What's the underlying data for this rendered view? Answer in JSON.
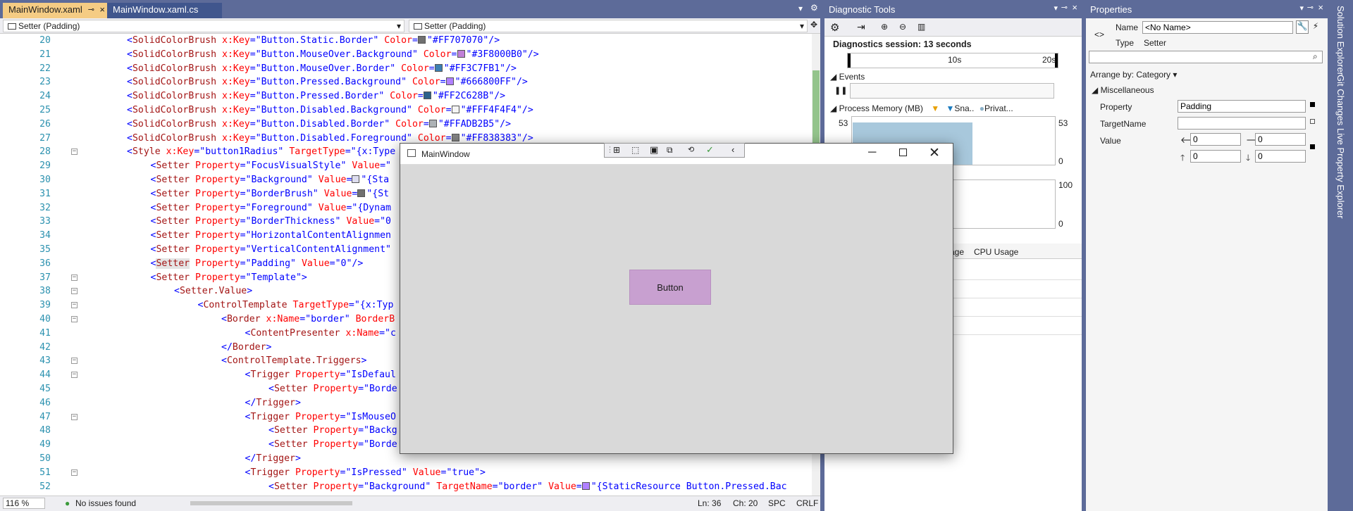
{
  "tabs": [
    {
      "label": "MainWindow.xaml",
      "active": true
    },
    {
      "label": "MainWindow.xaml.cs",
      "active": false
    }
  ],
  "nav": {
    "left": "Setter (Padding)",
    "right": "Setter (Padding)"
  },
  "code_lines": [
    {
      "n": "20",
      "indent": 0,
      "html": "<span class='cb'>&lt;</span><span class='cbr'>SolidColorBrush</span> <span class='cr'>x:Key</span><span class='cb'>=\"Button.Static.Border\"</span> <span class='cr'>Color</span><span class='cb'>=</span><span class='sw' style='background:#707070'></span><span class='cb'>\"#FF707070\"/&gt;</span>"
    },
    {
      "n": "21",
      "indent": 0,
      "html": "<span class='cb'>&lt;</span><span class='cbr'>SolidColorBrush</span> <span class='cr'>x:Key</span><span class='cb'>=\"Button.MouseOver.Background\"</span> <span class='cr'>Color</span><span class='cb'>=</span><span class='sw' style='background:#c080d8'></span><span class='cb'>\"#3F8000B0\"/&gt;</span>"
    },
    {
      "n": "22",
      "indent": 0,
      "html": "<span class='cb'>&lt;</span><span class='cbr'>SolidColorBrush</span> <span class='cr'>x:Key</span><span class='cb'>=\"Button.MouseOver.Border\"</span> <span class='cr'>Color</span><span class='cb'>=</span><span class='sw' style='background:#3c7fb1'></span><span class='cb'>\"#FF3C7FB1\"/&gt;</span>"
    },
    {
      "n": "23",
      "indent": 0,
      "html": "<span class='cb'>&lt;</span><span class='cbr'>SolidColorBrush</span> <span class='cr'>x:Key</span><span class='cb'>=\"Button.Pressed.Background\"</span> <span class='cr'>Color</span><span class='cb'>=</span><span class='sw' style='background:#b080ff'></span><span class='cb'>\"#666800FF\"/&gt;</span>"
    },
    {
      "n": "24",
      "indent": 0,
      "html": "<span class='cb'>&lt;</span><span class='cbr'>SolidColorBrush</span> <span class='cr'>x:Key</span><span class='cb'>=\"Button.Pressed.Border\"</span> <span class='cr'>Color</span><span class='cb'>=</span><span class='sw' style='background:#2c628b'></span><span class='cb'>\"#FF2C628B\"/&gt;</span>"
    },
    {
      "n": "25",
      "indent": 0,
      "html": "<span class='cb'>&lt;</span><span class='cbr'>SolidColorBrush</span> <span class='cr'>x:Key</span><span class='cb'>=\"Button.Disabled.Background\"</span> <span class='cr'>Color</span><span class='cb'>=</span><span class='sw' style='background:#f4f4f4'></span><span class='cb'>\"#FFF4F4F4\"/&gt;</span>"
    },
    {
      "n": "26",
      "indent": 0,
      "html": "<span class='cb'>&lt;</span><span class='cbr'>SolidColorBrush</span> <span class='cr'>x:Key</span><span class='cb'>=\"Button.Disabled.Border\"</span> <span class='cr'>Color</span><span class='cb'>=</span><span class='sw' style='background:#adb2b5'></span><span class='cb'>\"#FFADB2B5\"/&gt;</span>"
    },
    {
      "n": "27",
      "indent": 0,
      "html": "<span class='cb'>&lt;</span><span class='cbr'>SolidColorBrush</span> <span class='cr'>x:Key</span><span class='cb'>=\"Button.Disabled.Foreground\"</span> <span class='cr'>Color</span><span class='cb'>=</span><span class='sw' style='background:#838383'></span><span class='cb'>\"#FF838383\"/&gt;</span>"
    },
    {
      "n": "28",
      "indent": 0,
      "html": "<span class='cb'>&lt;</span><span class='cbr'>Style</span> <span class='cr'>x:Key</span><span class='cb'>=\"button1Radius\"</span> <span class='cr'>TargetType</span><span class='cb'>=\"{x:Type</span>"
    },
    {
      "n": "29",
      "indent": 1,
      "html": "<span class='cb'>&lt;</span><span class='cbr'>Setter</span> <span class='cr'>Property</span><span class='cb'>=\"FocusVisualStyle\"</span> <span class='cr'>Value</span><span class='cb'>=\"</span>"
    },
    {
      "n": "30",
      "indent": 1,
      "html": "<span class='cb'>&lt;</span><span class='cbr'>Setter</span> <span class='cr'>Property</span><span class='cb'>=\"Background\"</span> <span class='cr'>Value</span><span class='cb'>=</span><span class='sw' style='background:#dde'></span><span class='cb'>\"{Sta</span>"
    },
    {
      "n": "31",
      "indent": 1,
      "html": "<span class='cb'>&lt;</span><span class='cbr'>Setter</span> <span class='cr'>Property</span><span class='cb'>=\"BorderBrush\"</span> <span class='cr'>Value</span><span class='cb'>=</span><span class='sw' style='background:#707070'></span><span class='cb'>\"{St</span>"
    },
    {
      "n": "32",
      "indent": 1,
      "html": "<span class='cb'>&lt;</span><span class='cbr'>Setter</span> <span class='cr'>Property</span><span class='cb'>=\"Foreground\"</span> <span class='cr'>Value</span><span class='cb'>=\"{Dynam</span>"
    },
    {
      "n": "33",
      "indent": 1,
      "html": "<span class='cb'>&lt;</span><span class='cbr'>Setter</span> <span class='cr'>Property</span><span class='cb'>=\"BorderThickness\"</span> <span class='cr'>Value</span><span class='cb'>=\"0</span>"
    },
    {
      "n": "34",
      "indent": 1,
      "html": "<span class='cb'>&lt;</span><span class='cbr'>Setter</span> <span class='cr'>Property</span><span class='cb'>=\"HorizontalContentAlignmen</span>"
    },
    {
      "n": "35",
      "indent": 1,
      "html": "<span class='cb'>&lt;</span><span class='cbr'>Setter</span> <span class='cr'>Property</span><span class='cb'>=\"VerticalContentAlignment\"</span>"
    },
    {
      "n": "36",
      "indent": 1,
      "html": "<span class='cb'>&lt;</span><span class='cbr' style='background:#e4e4e4'>Setter</span> <span class='cr'>Property</span><span class='cb'>=\"Padding\"</span> <span class='cr'>Value</span><span class='cb'>=\"0\"/&gt;</span>"
    },
    {
      "n": "37",
      "indent": 1,
      "html": "<span class='cb'>&lt;</span><span class='cbr'>Setter</span> <span class='cr'>Property</span><span class='cb'>=\"Template\"&gt;</span>"
    },
    {
      "n": "38",
      "indent": 2,
      "html": "<span class='cb'>&lt;</span><span class='cbr'>Setter.Value</span><span class='cb'>&gt;</span>"
    },
    {
      "n": "39",
      "indent": 3,
      "html": "<span class='cb'>&lt;</span><span class='cbr'>ControlTemplate</span> <span class='cr'>TargetType</span><span class='cb'>=\"{x:Typ</span>"
    },
    {
      "n": "40",
      "indent": 4,
      "html": "<span class='cb'>&lt;</span><span class='cbr'>Border</span> <span class='cr'>x:Name</span><span class='cb'>=\"border\"</span> <span class='cr'>BorderB</span>"
    },
    {
      "n": "41",
      "indent": 5,
      "html": "<span class='cb'>&lt;</span><span class='cbr'>ContentPresenter</span> <span class='cr'>x:Name</span><span class='cb'>=\"c</span>"
    },
    {
      "n": "42",
      "indent": 4,
      "html": "<span class='cb'>&lt;/</span><span class='cbr'>Border</span><span class='cb'>&gt;</span>"
    },
    {
      "n": "43",
      "indent": 4,
      "html": "<span class='cb'>&lt;</span><span class='cbr'>ControlTemplate.Triggers</span><span class='cb'>&gt;</span>"
    },
    {
      "n": "44",
      "indent": 5,
      "html": "<span class='cb'>&lt;</span><span class='cbr'>Trigger</span> <span class='cr'>Property</span><span class='cb'>=\"IsDefaul</span>"
    },
    {
      "n": "45",
      "indent": 6,
      "html": "<span class='cb'>&lt;</span><span class='cbr'>Setter</span> <span class='cr'>Property</span><span class='cb'>=\"Borde</span>"
    },
    {
      "n": "46",
      "indent": 5,
      "html": "<span class='cb'>&lt;/</span><span class='cbr'>Trigger</span><span class='cb'>&gt;</span>"
    },
    {
      "n": "47",
      "indent": 5,
      "html": "<span class='cb'>&lt;</span><span class='cbr'>Trigger</span> <span class='cr'>Property</span><span class='cb'>=\"IsMouseO</span>"
    },
    {
      "n": "48",
      "indent": 6,
      "html": "<span class='cb'>&lt;</span><span class='cbr'>Setter</span> <span class='cr'>Property</span><span class='cb'>=\"Backg</span>"
    },
    {
      "n": "49",
      "indent": 6,
      "html": "<span class='cb'>&lt;</span><span class='cbr'>Setter</span> <span class='cr'>Property</span><span class='cb'>=\"Borde</span>"
    },
    {
      "n": "50",
      "indent": 5,
      "html": "<span class='cb'>&lt;/</span><span class='cbr'>Trigger</span><span class='cb'>&gt;</span>"
    },
    {
      "n": "51",
      "indent": 5,
      "html": "<span class='cb'>&lt;</span><span class='cbr'>Trigger</span> <span class='cr'>Property</span><span class='cb'>=\"IsPressed\"</span> <span class='cr'>Value</span><span class='cb'>=\"true\"&gt;</span>"
    },
    {
      "n": "52",
      "indent": 6,
      "html": "<span class='cb'>&lt;</span><span class='cbr'>Setter</span> <span class='cr'>Property</span><span class='cb'>=\"Background\"</span> <span class='cr'>TargetName</span><span class='cb'>=\"border\"</span> <span class='cr'>Value</span><span class='cb'>=</span><span class='sw' style='background:#b080ff'></span><span class='cb'>\"{StaticResource Button.Pressed.Bac</span>"
    }
  ],
  "status": {
    "zoom": "116 %",
    "issues": "No issues found",
    "ln": "Ln: 36",
    "ch": "Ch: 20",
    "spc": "SPC",
    "crlf": "CRLF"
  },
  "app": {
    "title": "MainWindow",
    "button": "Button"
  },
  "diag": {
    "title": "Diagnostic Tools",
    "session": "Diagnostics session: 13 seconds",
    "tick1": "10s",
    "tick2": "20s",
    "events": "Events",
    "memory": "Process Memory (MB)",
    "legend_snap": "Sna..",
    "legend_priv": "Privat...",
    "mem_max": "53",
    "mem_min": "0",
    "cpu_max": "100",
    "cpu_min": "0",
    "tab_usage": "age",
    "tab_cpu": "CPU Usage"
  },
  "props": {
    "title": "Properties",
    "name_label": "Name",
    "name_value": "<No Name>",
    "type_label": "Type",
    "type_value": "Setter",
    "arrange": "Arrange by: Category",
    "category": "Miscellaneous",
    "property_label": "Property",
    "property_value": "Padding",
    "targetname_label": "TargetName",
    "targetname_value": "",
    "value_label": "Value",
    "v1": "0",
    "v2": "0",
    "v3": "0",
    "v4": "0"
  },
  "rail": [
    "Solution Explorer",
    "Git Changes",
    "Live Property Explorer"
  ]
}
